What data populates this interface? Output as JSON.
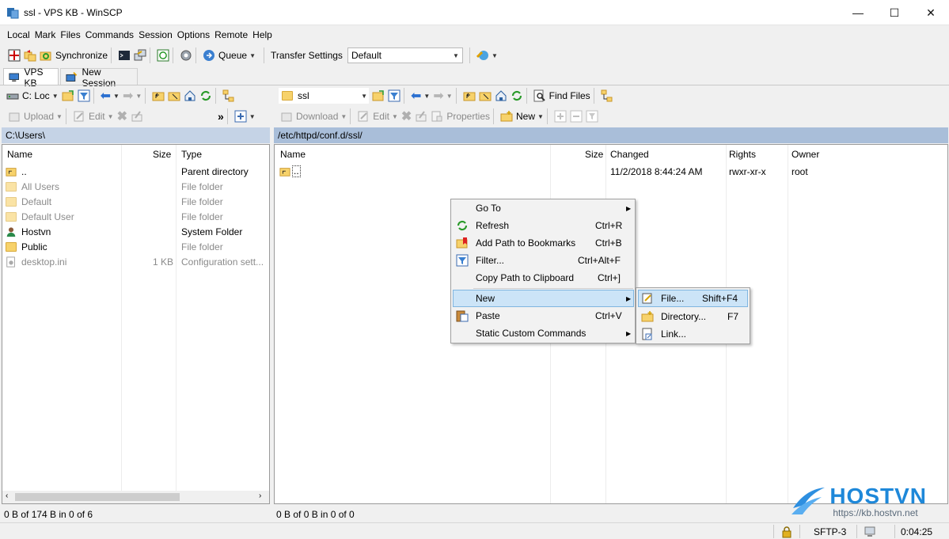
{
  "window": {
    "title": "ssl - VPS KB - WinSCP",
    "controls": {
      "minimize": "—",
      "maximize": "☐",
      "close": "✕"
    }
  },
  "menubar": [
    "Local",
    "Mark",
    "Files",
    "Commands",
    "Session",
    "Options",
    "Remote",
    "Help"
  ],
  "toolbar1": {
    "synchronize": "Synchronize",
    "queue": "Queue",
    "transfer_settings_label": "Transfer Settings",
    "transfer_settings_value": "Default"
  },
  "tabs": [
    {
      "label": "VPS KB",
      "active": true
    },
    {
      "label": "New Session",
      "active": false
    }
  ],
  "left_nav": {
    "drive": "C: Loc",
    "more": "»"
  },
  "left_actions": {
    "upload": "Upload",
    "edit": "Edit"
  },
  "left_panel": {
    "path": "C:\\Users\\",
    "columns": {
      "name": "Name",
      "size": "Size",
      "type": "Type"
    },
    "rows": [
      {
        "name": "..",
        "size": "",
        "type": "Parent directory",
        "kind": "up",
        "dim": false
      },
      {
        "name": "All Users",
        "size": "",
        "type": "File folder",
        "kind": "folder",
        "dim": true
      },
      {
        "name": "Default",
        "size": "",
        "type": "File folder",
        "kind": "folder",
        "dim": true
      },
      {
        "name": "Default User",
        "size": "",
        "type": "File folder",
        "kind": "folder",
        "dim": true
      },
      {
        "name": "Hostvn",
        "size": "",
        "type": "System Folder",
        "kind": "user",
        "dim": false
      },
      {
        "name": "Public",
        "size": "",
        "type": "File folder",
        "kind": "folder",
        "dim": false
      },
      {
        "name": "desktop.ini",
        "size": "1 KB",
        "type": "Configuration sett...",
        "kind": "file",
        "dim": true
      }
    ],
    "status": "0 B of 174 B in 0 of 6"
  },
  "right_nav": {
    "dir": "ssl",
    "find_files": "Find Files"
  },
  "right_actions": {
    "download": "Download",
    "edit": "Edit",
    "properties": "Properties",
    "new": "New"
  },
  "right_panel": {
    "path": "/etc/httpd/conf.d/ssl/",
    "columns": {
      "name": "Name",
      "size": "Size",
      "changed": "Changed",
      "rights": "Rights",
      "owner": "Owner"
    },
    "rows": [
      {
        "name": "..",
        "size": "",
        "changed": "11/2/2018 8:44:24 AM",
        "rights": "rwxr-xr-x",
        "owner": "root"
      }
    ],
    "status": "0 B of 0 B in 0 of 0"
  },
  "context_menu": {
    "items": [
      {
        "label": "Go To",
        "shortcut": "",
        "submenu": true,
        "icon": ""
      },
      {
        "label": "Refresh",
        "shortcut": "Ctrl+R",
        "submenu": false,
        "icon": "refresh"
      },
      {
        "label": "Add Path to Bookmarks",
        "shortcut": "Ctrl+B",
        "submenu": false,
        "icon": "bookmark"
      },
      {
        "label": "Filter...",
        "shortcut": "Ctrl+Alt+F",
        "submenu": false,
        "icon": "filter"
      },
      {
        "label": "Copy Path to Clipboard",
        "shortcut": "Ctrl+]",
        "submenu": false,
        "icon": ""
      },
      {
        "label": "New",
        "shortcut": "",
        "submenu": true,
        "icon": "",
        "highlight": true
      },
      {
        "label": "Paste",
        "shortcut": "Ctrl+V",
        "submenu": false,
        "icon": "paste"
      },
      {
        "label": "Static Custom Commands",
        "shortcut": "",
        "submenu": true,
        "icon": ""
      }
    ]
  },
  "submenu": {
    "items": [
      {
        "label": "File...",
        "shortcut": "Shift+F4",
        "icon": "new-file",
        "highlight": true
      },
      {
        "label": "Directory...",
        "shortcut": "F7",
        "icon": "new-folder"
      },
      {
        "label": "Link...",
        "shortcut": "",
        "icon": "link"
      }
    ]
  },
  "statusbar": {
    "protocol": "SFTP-3",
    "time": "0:04:25"
  },
  "watermark": {
    "brand": "HOSTVN",
    "url": "https://kb.hostvn.net"
  },
  "colors": {
    "accent": "#1e88d9",
    "selection": "#cce4f7",
    "panel_header_left": "#c5d3e6",
    "panel_header_right": "#a9bed9"
  }
}
